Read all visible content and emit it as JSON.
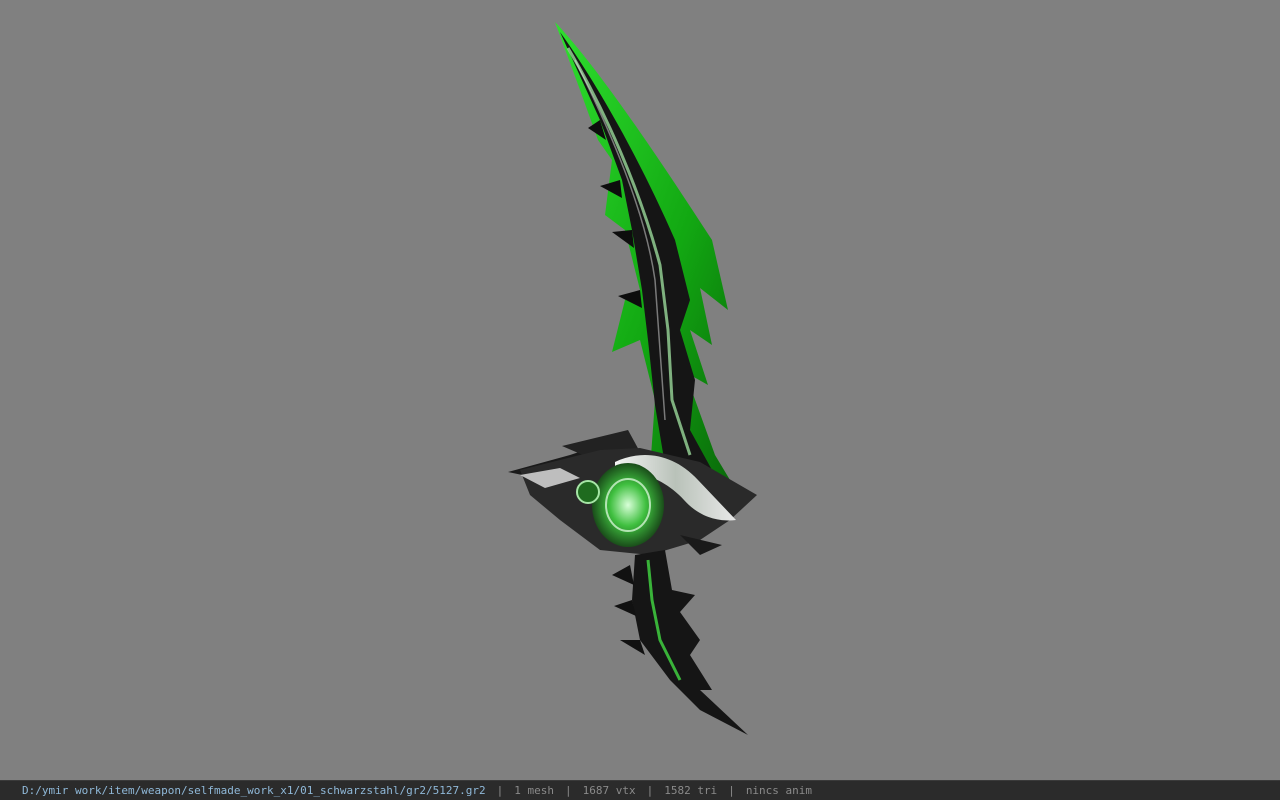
{
  "viewport": {
    "background": "#808080",
    "model_icon": "green-curved-blade-weapon"
  },
  "status_bar": {
    "path": "D:/ymir work/item/weapon/selfmade_work_x1/01_schwarzstahl/gr2/5127.gr2",
    "separator": "|",
    "mesh": "1 mesh",
    "vertices": "1687 vtx",
    "triangles": "1582 tri",
    "anim": "nincs anim",
    "path_color": "#8fb8d8",
    "text_color": "#8a8a8a"
  }
}
